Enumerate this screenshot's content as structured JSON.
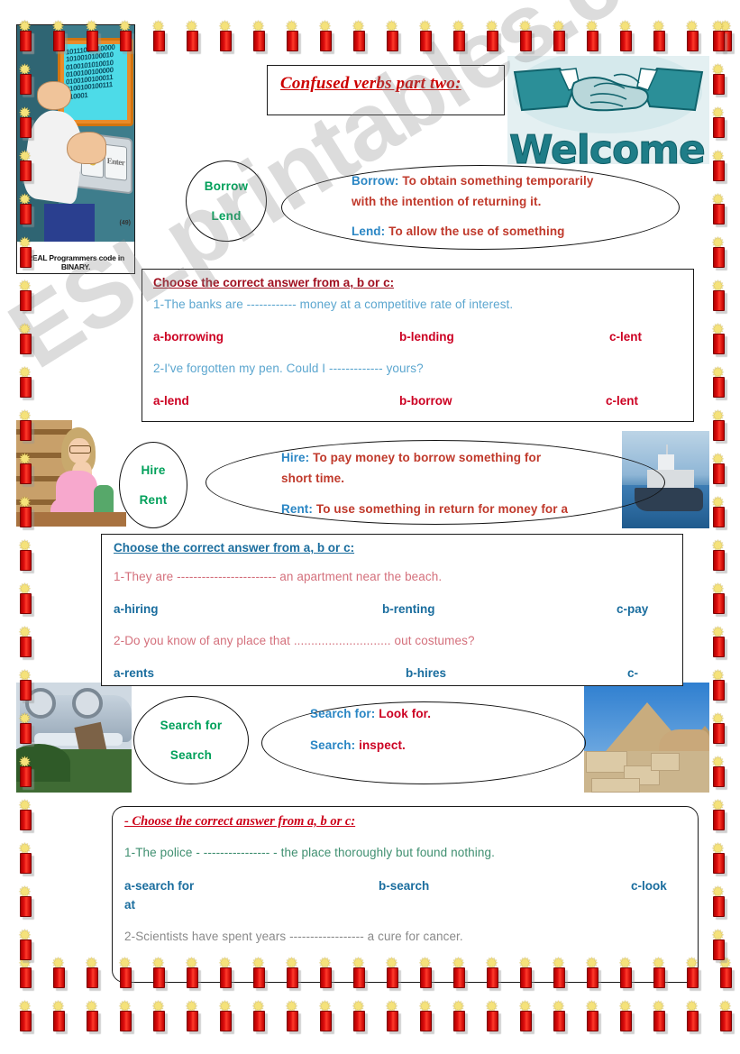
{
  "document": {
    "title": "Confused verbs part two:",
    "watermark": "ESLprintables.com"
  },
  "images": {
    "programmer": {
      "name": "binary-programmer-cartoon",
      "caption": "REAL Programmers code in BINARY.",
      "screen_binary": "10111011110000\n1010010100010\n0100101010010\n0100100100000\n0100100100011\n0100100100111\n010001",
      "key_1": "1",
      "key_0": "0",
      "key_enter": "Enter",
      "corner_tag": "(49)"
    },
    "welcome": {
      "name": "welcome-handshake",
      "text": "Welcome!",
      "color": "#1f7d88"
    },
    "lady": {
      "name": "woman-shopping-cartoon"
    },
    "ship": {
      "name": "ship-at-sea-photo"
    },
    "car": {
      "name": "overturned-car-photo"
    },
    "pyramid": {
      "name": "pyramid-sphinx-photo"
    }
  },
  "colors": {
    "title_red": "#cc0000",
    "green": "#00a05a",
    "def_label_blue": "#2a86c4",
    "def_text_red": "#c0392b",
    "option_red": "#cc0022",
    "option_blue": "#1a6d9e",
    "question_blue": "#5ba6cf",
    "question_pink": "#d4707c",
    "question_green": "#3f8f70",
    "question_gray": "#8a8a8a"
  },
  "sections": [
    {
      "id": "borrow-lend",
      "circle": {
        "word1": "Borrow",
        "word2": "Lend"
      },
      "definitions": [
        {
          "label": "Borrow:",
          "text": "To obtain something temporarily"
        },
        {
          "label": "",
          "text": "with the intention of returning it."
        },
        {
          "label": "Lend:",
          "text": "To allow the use of something"
        }
      ],
      "exercise": {
        "instruction": "Choose the correct answer from a, b or c:",
        "questions": [
          {
            "text": "1-The banks are ------------ money at a competitive rate of interest.",
            "options": [
              "a-borrowing",
              "b-lending",
              "c-lent"
            ]
          },
          {
            "text": "2-I've forgotten my pen. Could I ------------- yours?",
            "options": [
              "a-lend",
              "b-borrow",
              "c-lent"
            ]
          }
        ]
      }
    },
    {
      "id": "hire-rent",
      "circle": {
        "word1": "Hire",
        "word2": "Rent"
      },
      "definitions": [
        {
          "label": "Hire:",
          "text": "To pay money to borrow something for"
        },
        {
          "label": "",
          "text": "short time."
        },
        {
          "label": "Rent:",
          "text": "To use something in return for money for a"
        }
      ],
      "exercise": {
        "instruction": "Choose the correct answer from a, b or c:",
        "questions": [
          {
            "text": "1-They are ------------------------ an apartment near the beach.",
            "options": [
              "a-hiring",
              "b-renting",
              "c-pay"
            ]
          },
          {
            "text": "2-Do you know of any place that ............................ out costumes?",
            "options": [
              "a-rents",
              "b-hires",
              "c-"
            ]
          }
        ]
      }
    },
    {
      "id": "search-for-search",
      "circle": {
        "word1": "Search for",
        "word2": "Search"
      },
      "definitions": [
        {
          "label": "Search for:",
          "text": "Look for."
        },
        {
          "label": "Search:",
          "text": "inspect."
        }
      ],
      "exercise": {
        "instruction": "- Choose the correct answer from a, b or c:",
        "questions": [
          {
            "text": "1-The police - ---------------- -  the place thoroughly but found nothing.",
            "options": [
              "a-search for",
              "b-search",
              "c-look",
              "at"
            ]
          },
          {
            "text": "2-Scientists have spent years ------------------ a cure for cancer.",
            "options": []
          }
        ]
      }
    }
  ]
}
